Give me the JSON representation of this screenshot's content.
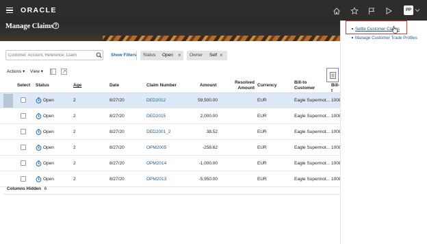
{
  "header": {
    "logo": "ORACLE",
    "avatar": "PP",
    "icons": [
      "hamburger-menu-icon",
      "home-icon",
      "favorites-star-icon",
      "watchlist-flag-icon",
      "play-icon",
      "chevron-down-icon"
    ]
  },
  "page": {
    "title": "Manage Claims"
  },
  "search": {
    "placeholder": "Customer, Account, Reference, Claim",
    "show_filters": "Show Filters",
    "chips": [
      {
        "key": "Status",
        "value": "Open"
      },
      {
        "key": "Owner",
        "value": "Self"
      }
    ]
  },
  "toolbar": {
    "actions": "Actions",
    "view": "View"
  },
  "table": {
    "headers": {
      "select": "Select",
      "status": "Status",
      "age": "Age",
      "date": "Date",
      "claim_number": "Claim Number",
      "amount": "Amount",
      "resolved_amount_1": "Resolved",
      "resolved_amount_2": "Amount",
      "currency": "Currency",
      "bill_to_customer_1": "Bill-to",
      "bill_to_customer_2": "Customer",
      "bill_to_more": "Bill-t"
    },
    "rows": [
      {
        "status": "Open",
        "age": "2",
        "date": "8/27/20",
        "claim_number": "DED2012",
        "amount": "59,500.00",
        "resolved_amount": "",
        "currency": "EUR",
        "customer": "Eagle Supermot...",
        "bill_to_more": "1008"
      },
      {
        "status": "Open",
        "age": "2",
        "date": "8/27/20",
        "claim_number": "DED2015",
        "amount": "2,000.00",
        "resolved_amount": "",
        "currency": "EUR",
        "customer": "Eagle Supermot...",
        "bill_to_more": "1008"
      },
      {
        "status": "Open",
        "age": "2",
        "date": "8/27/20",
        "claim_number": "DED2001_2",
        "amount": "38.52",
        "resolved_amount": "",
        "currency": "EUR",
        "customer": "Eagle Supermot...",
        "bill_to_more": "1008"
      },
      {
        "status": "Open",
        "age": "2",
        "date": "8/27/20",
        "claim_number": "OPM2005",
        "amount": "-258.62",
        "resolved_amount": "",
        "currency": "EUR",
        "customer": "Eagle Supermot...",
        "bill_to_more": "1008"
      },
      {
        "status": "Open",
        "age": "2",
        "date": "8/27/20",
        "claim_number": "OPM2014",
        "amount": "-1,000.00",
        "resolved_amount": "",
        "currency": "EUR",
        "customer": "Eagle Supermot...",
        "bill_to_more": "1008"
      },
      {
        "status": "Open",
        "age": "2",
        "date": "8/27/20",
        "claim_number": "OPM2013",
        "amount": "-5,950.00",
        "resolved_amount": "",
        "currency": "EUR",
        "customer": "Eagle Supermot...",
        "bill_to_more": "1008"
      }
    ],
    "columns_hidden_label": "Columns Hidden",
    "columns_hidden_count": "6"
  },
  "tasks": {
    "items": [
      {
        "label": "Settle Customer Claims"
      },
      {
        "label": "Manage Customer Trade Profiles"
      }
    ]
  },
  "colors": {
    "header_bg": "#2e2d2b",
    "link": "#1a5a86",
    "selected_row": "#dde9f6",
    "highlight": "#d83b3b"
  }
}
